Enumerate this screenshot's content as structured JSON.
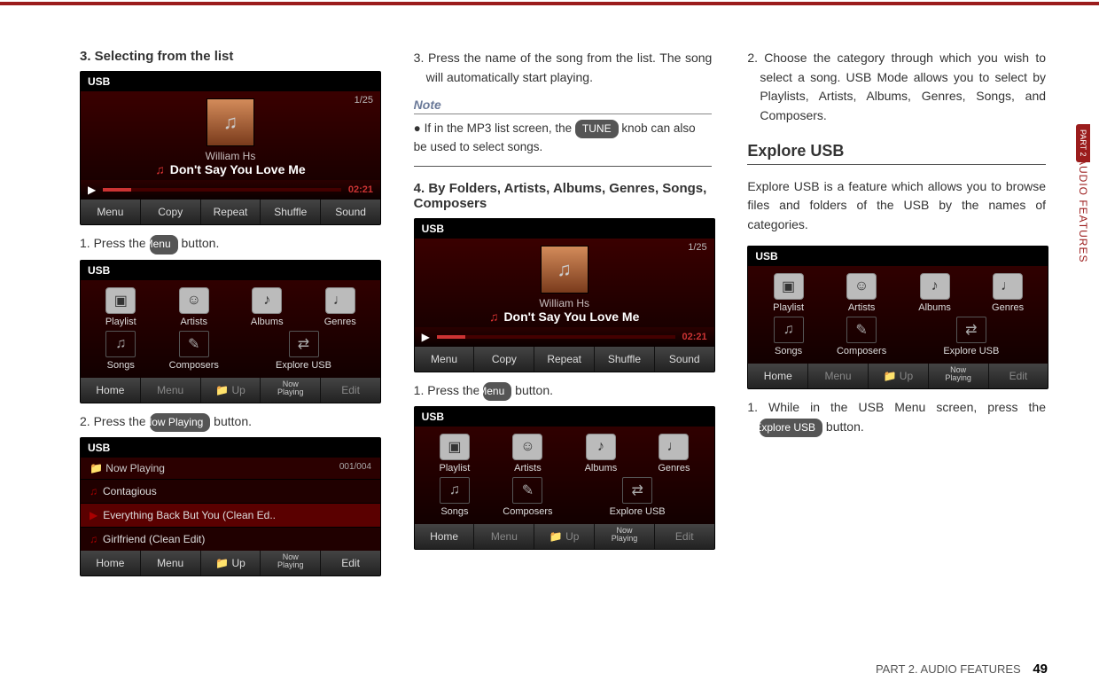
{
  "page": {
    "footer_section": "PART 2. AUDIO FEATURES",
    "page_number": "49",
    "side_tab_part": "PART 2",
    "side_tab_label": "AUDIO FEATURES"
  },
  "buttons": {
    "menu": "Menu",
    "now_playing": "Now Playing",
    "tune": "TUNE",
    "explore_usb": "Explore USB"
  },
  "col1": {
    "heading": "3. Selecting from the list",
    "step1_a": "1. Press the ",
    "step1_b": " button.",
    "step2_a": "2. Press the ",
    "step2_b": " button."
  },
  "col2": {
    "step3": "3. Press the name of the song from the list. The song will automatically start playing.",
    "note_label": "Note",
    "note_a": "If in the MP3 list screen, the ",
    "note_b": " knob can also be used to select songs.",
    "heading4": "4. By Folders, Artists, Albums, Genres, Songs, Composers",
    "step4_1a": "1. Press the ",
    "step4_1b": " button."
  },
  "col3": {
    "step2": "2. Choose the category through which you wish to select a song. USB Mode allows you to select by Playlists, Artists, Albums, Genres, Songs, and Composers.",
    "section_heading": "Explore USB",
    "intro": "Explore USB is a feature which allows you to browse files and folders of the USB by the names of categories.",
    "step1_a": "1. While in the USB Menu screen, press the ",
    "step1_b": " button."
  },
  "shot_player": {
    "title": "USB",
    "counter": "1/25",
    "artist": "William Hs",
    "track": "Don't Say You Love Me",
    "time": "02:21",
    "bb": [
      "Menu",
      "Copy",
      "Repeat",
      "Shuffle",
      "Sound"
    ]
  },
  "shot_menu": {
    "title": "USB",
    "cats_top": [
      "Playlist",
      "Artists",
      "Albums",
      "Genres"
    ],
    "cats_bot": [
      "Songs",
      "Composers",
      "Explore USB"
    ],
    "bb": [
      "Home",
      "Menu",
      "Up",
      "Now Playing",
      "Edit"
    ],
    "bb_now_top": "Now",
    "bb_now_bot": "Playing"
  },
  "shot_list": {
    "title": "USB",
    "folder": "Now Playing",
    "counter": "001/004",
    "rows": [
      "Contagious",
      "Everything Back But You (Clean Ed..",
      "Girlfriend (Clean Edit)"
    ],
    "bb": [
      "Home",
      "Menu",
      "Up",
      "Now Playing",
      "Edit"
    ]
  }
}
